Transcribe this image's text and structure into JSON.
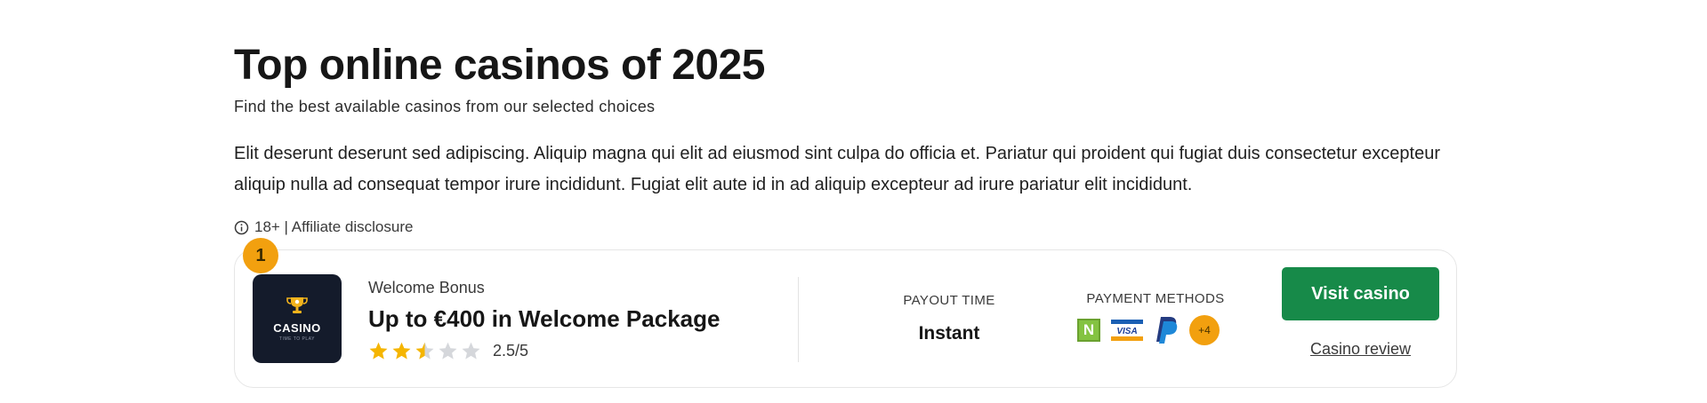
{
  "header": {
    "title": "Top online casinos of 2025",
    "subtitle": "Find the best available casinos from our selected choices",
    "intro": "Elit deserunt deserunt sed adipiscing. Aliquip magna qui elit ad eiusmod sint culpa do officia et. Pariatur qui proident qui fugiat duis consectetur excepteur aliquip nulla ad consequat tempor irure incididunt. Fugiat elit aute id in ad aliquip excepteur ad irure pariatur elit incididunt.",
    "disclosure": "18+ | Affiliate disclosure",
    "disclosure_icon": "info-icon"
  },
  "casino": {
    "rank": "1",
    "logo": {
      "word": "CASINO",
      "tagline": "TIME TO PLAY",
      "icon": "trophy-icon",
      "background": "#141b2b"
    },
    "bonus_label": "Welcome Bonus",
    "bonus_title": "Up to €400 in Welcome Package",
    "rating": {
      "value": 2.5,
      "max": 5,
      "text": "2.5/5"
    },
    "payout_label": "PAYOUT TIME",
    "payout_value": "Instant",
    "payment_label": "PAYMENT METHODS",
    "payment_methods": [
      {
        "name": "Neteller",
        "icon": "neteller-icon",
        "glyph": "N"
      },
      {
        "name": "Visa",
        "icon": "visa-icon",
        "glyph": "VISA"
      },
      {
        "name": "PayPal",
        "icon": "paypal-icon"
      }
    ],
    "payment_more": "+4",
    "visit_label": "Visit casino",
    "review_label": "Casino review"
  },
  "colors": {
    "accent_green": "#178a49",
    "rank_orange": "#f2a00f",
    "star_gold": "#f5b500",
    "star_empty": "#d5d7db"
  }
}
